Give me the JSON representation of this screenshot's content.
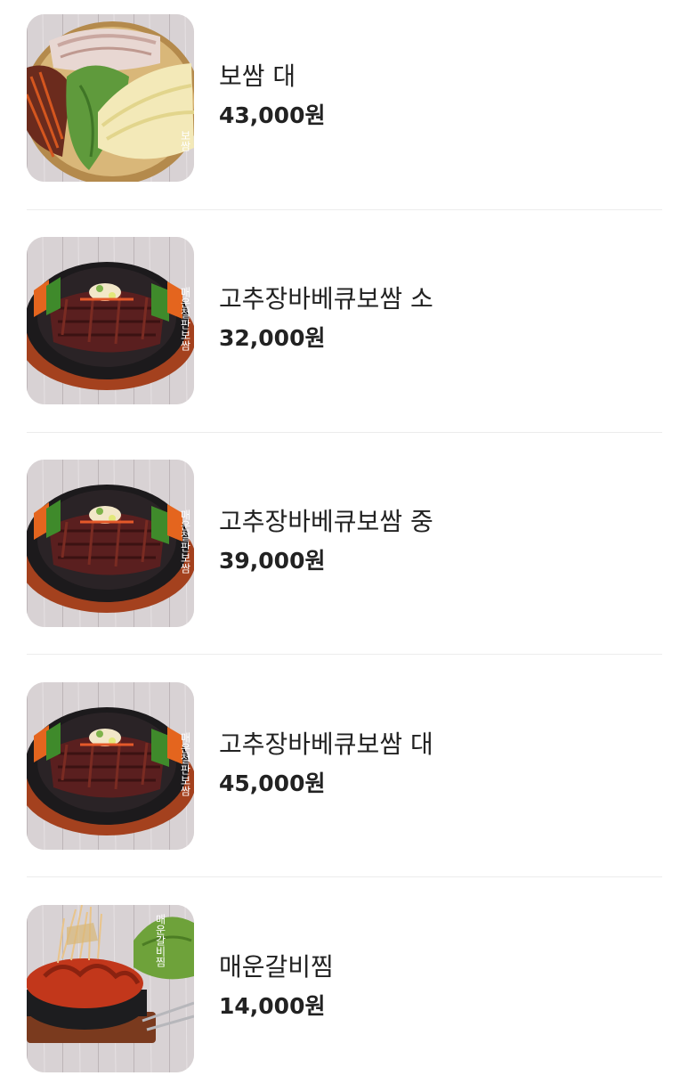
{
  "menu": {
    "items": [
      {
        "name": "보쌈 대",
        "price": "43,000원",
        "image": "bossam-platter-image",
        "image_caption": "보쌈"
      },
      {
        "name": "고추장바베큐보쌈 소",
        "price": "32,000원",
        "image": "bbq-bossam-iron-plate-image",
        "image_caption": "매운철판보쌈"
      },
      {
        "name": "고추장바베큐보쌈 중",
        "price": "39,000원",
        "image": "bbq-bossam-iron-plate-image",
        "image_caption": "매운철판보쌈"
      },
      {
        "name": "고추장바베큐보쌈 대",
        "price": "45,000원",
        "image": "bbq-bossam-iron-plate-image",
        "image_caption": "매운철판보쌈"
      },
      {
        "name": "매운갈비찜",
        "price": "14,000원",
        "image": "spicy-galbijjim-image",
        "image_caption": "매운갈비찜"
      }
    ]
  },
  "colors": {
    "text": "#222222",
    "divider": "#ececec",
    "background": "#ffffff"
  }
}
